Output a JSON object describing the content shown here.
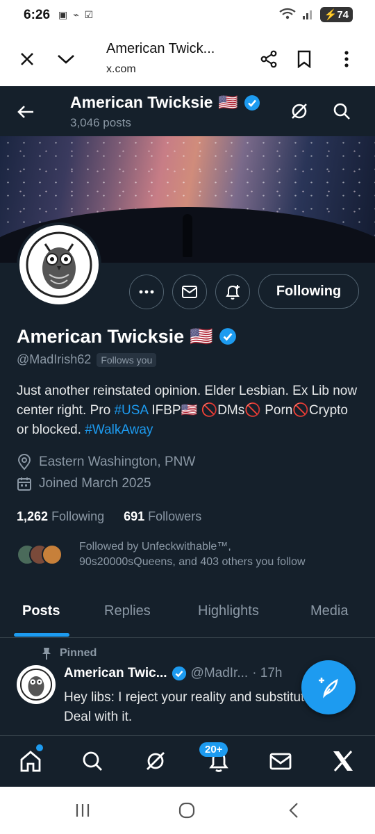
{
  "status_bar": {
    "time": "6:26",
    "battery": "74"
  },
  "browser": {
    "title": "American Twick...",
    "url": "x.com"
  },
  "header": {
    "name": "American Twicksie",
    "flag": "🇺🇸",
    "posts": "3,046 posts"
  },
  "profile": {
    "name": "American Twicksie",
    "flag": "🇺🇸",
    "handle": "@MadIrish62",
    "follows_you": "Follows you",
    "bio_1": "Just another reinstated opinion. Elder Lesbian. Ex Lib now center right. Pro ",
    "bio_tag1": "#USA",
    "bio_2": " IFBP",
    "bio_3": "DMs",
    "bio_4": "Porn",
    "bio_5": "Crypto or blocked. ",
    "bio_tag2": "#WalkAway",
    "location": "Eastern Washington, PNW",
    "joined": "Joined March 2025",
    "following_count": "1,262",
    "following_label": "Following",
    "followers_count": "691",
    "followers_label": "Followers",
    "followed_by_1": "Followed by Unfeckwithable™,",
    "followed_by_2": "90s20000sQueens, and 403 others you follow"
  },
  "actions": {
    "following": "Following"
  },
  "tabs": [
    {
      "label": "Posts",
      "active": true
    },
    {
      "label": "Replies"
    },
    {
      "label": "Highlights"
    },
    {
      "label": "Media"
    }
  ],
  "post": {
    "pinned": "Pinned",
    "name": "American Twic...",
    "handle": "@MadIr...",
    "time": "· 17h",
    "text": "Hey libs: I reject your reality and substitute mine.  Deal with it."
  },
  "bottom_nav": {
    "notifications_badge": "20+"
  },
  "colors": {
    "background": "#15202b",
    "accent": "#1d9bf0",
    "muted": "#8b98a5"
  }
}
